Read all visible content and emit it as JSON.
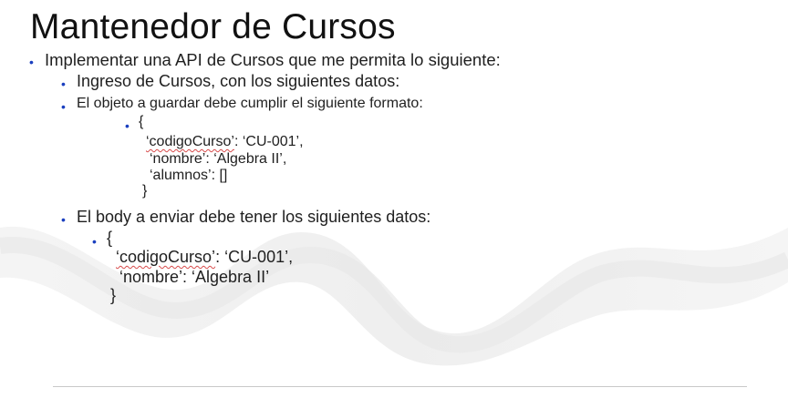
{
  "slide": {
    "title": "Mantenedor de Cursos",
    "bullet_main": "Implementar una API de Cursos que me permita lo siguiente:",
    "sub_ingreso": "Ingreso de Cursos, con los siguientes datos:",
    "sub_objeto": "El objeto a guardar debe cumplir el siguiente formato:",
    "obj_open": "{",
    "obj_line1_key": "‘codigoCurso’",
    "obj_line1_rest": ": ‘CU-001’,",
    "obj_line2": "‘nombre’: ‘Algebra II’,",
    "obj_line3": "‘alumnos’: []",
    "obj_close": "}",
    "sub_body": "El body a enviar debe tener los siguientes datos:",
    "body_open": "{",
    "body_line1_key": "‘codigoCurso’",
    "body_line1_rest": ": ‘CU-001’,",
    "body_line2": "‘nombre’: ‘Algebra II’",
    "body_close": "}"
  },
  "colors": {
    "bullet": "#1a3fbf",
    "text": "#1f1f1f",
    "squiggle": "#d84b4b",
    "wave": "#efefef"
  }
}
